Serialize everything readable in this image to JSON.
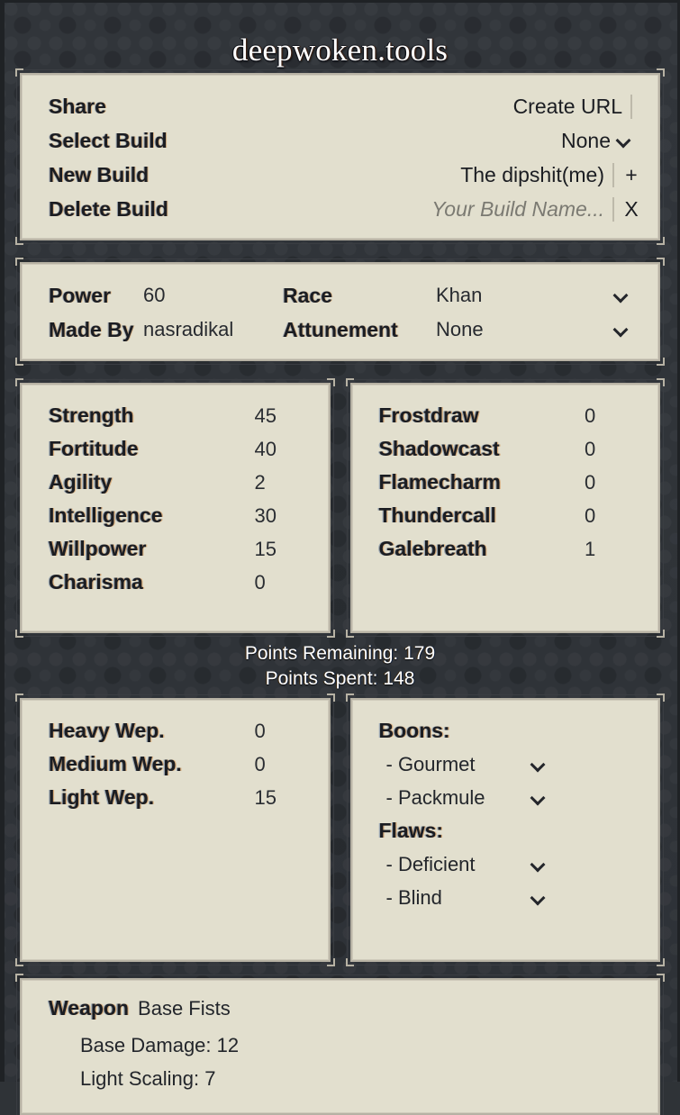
{
  "app": {
    "title": "deepwoken.tools",
    "accent_panel_bg": "#e2dfce",
    "accent_border": "#b7b2a4",
    "backdrop": "#31353a"
  },
  "share_panel": {
    "rows": [
      {
        "label": "Share",
        "value": "Create URL",
        "value_muted": false,
        "divider": true,
        "action": "",
        "chevron": false
      },
      {
        "label": "Select Build",
        "value": "None",
        "value_muted": false,
        "divider": false,
        "action": "",
        "chevron": true
      },
      {
        "label": "New Build",
        "value": "The dipshit(me)",
        "value_muted": false,
        "divider": true,
        "action": "+",
        "chevron": false
      },
      {
        "label": "Delete Build",
        "value": "Your Build Name...",
        "value_muted": true,
        "divider": true,
        "action": "X",
        "chevron": false
      }
    ]
  },
  "info_panel": {
    "power_label": "Power",
    "power_value": "60",
    "made_by_label": "Made By",
    "made_by_value": "nasradikal",
    "race_label": "Race",
    "race_value": "Khan",
    "attunement_label": "Attunement",
    "attunement_value": "None"
  },
  "attributes": {
    "items": [
      {
        "name": "Strength",
        "value": "45"
      },
      {
        "name": "Fortitude",
        "value": "40"
      },
      {
        "name": "Agility",
        "value": "2"
      },
      {
        "name": "Intelligence",
        "value": "30"
      },
      {
        "name": "Willpower",
        "value": "15"
      },
      {
        "name": "Charisma",
        "value": "0"
      }
    ]
  },
  "attunements": {
    "items": [
      {
        "name": "Frostdraw",
        "value": "0"
      },
      {
        "name": "Shadowcast",
        "value": "0"
      },
      {
        "name": "Flamecharm",
        "value": "0"
      },
      {
        "name": "Thundercall",
        "value": "0"
      },
      {
        "name": "Galebreath",
        "value": "1"
      }
    ]
  },
  "points": {
    "remaining": "Points Remaining: 179",
    "spent": "Points Spent: 148"
  },
  "weapons": {
    "items": [
      {
        "name": "Heavy Wep.",
        "value": "0"
      },
      {
        "name": "Medium Wep.",
        "value": "0"
      },
      {
        "name": "Light Wep.",
        "value": "15"
      }
    ]
  },
  "traits": {
    "boons_label": "Boons:",
    "boons": [
      {
        "name": "- Gourmet"
      },
      {
        "name": "- Packmule"
      }
    ],
    "flaws_label": "Flaws:",
    "flaws": [
      {
        "name": "- Deficient"
      },
      {
        "name": "- Blind"
      }
    ]
  },
  "weapon_detail": {
    "label": "Weapon",
    "name": "Base Fists",
    "lines": [
      "Base Damage: 12",
      "Light Scaling: 7"
    ]
  }
}
